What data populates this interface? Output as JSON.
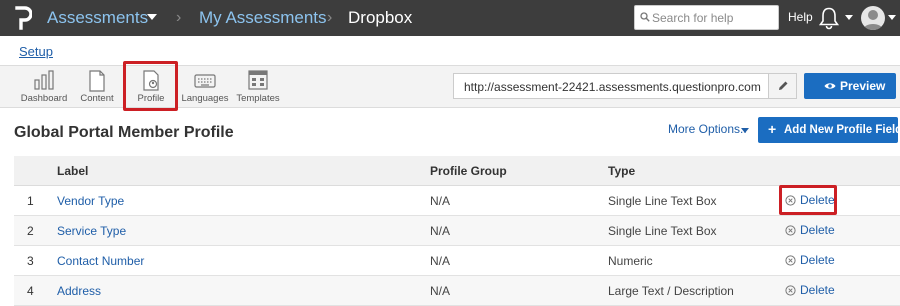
{
  "topbar": {
    "crumb_assessments": "Assessments",
    "crumb_my_assessments": "My Assessments",
    "crumb_current": "Dropbox",
    "separator": "›",
    "search_placeholder": "Search for help",
    "help_label": "Help"
  },
  "setup": {
    "link_label": "Setup"
  },
  "toolbar": {
    "items": [
      {
        "label": "Dashboard",
        "icon": "bar-chart-icon"
      },
      {
        "label": "Content",
        "icon": "document-icon"
      },
      {
        "label": "Profile",
        "icon": "profile-card-icon",
        "highlighted": true
      },
      {
        "label": "Languages",
        "icon": "keyboard-icon"
      },
      {
        "label": "Templates",
        "icon": "template-grid-icon"
      }
    ],
    "url_value": "http://assessment-22421.assessments.questionpro.com",
    "preview_label": "Preview"
  },
  "page": {
    "title": "Global Portal Member Profile",
    "more_options_label": "More Options..",
    "add_button_plus": "+",
    "add_button_label": "Add New Profile Field"
  },
  "table": {
    "headers": {
      "label": "Label",
      "group": "Profile Group",
      "type": "Type"
    },
    "rows": [
      {
        "num": "1",
        "label": "Vendor Type",
        "group": "N/A",
        "type": "Single Line Text Box",
        "action": "Delete",
        "highlighted": true
      },
      {
        "num": "2",
        "label": "Service Type",
        "group": "N/A",
        "type": "Single Line Text Box",
        "action": "Delete"
      },
      {
        "num": "3",
        "label": "Contact Number",
        "group": "N/A",
        "type": "Numeric",
        "action": "Delete"
      },
      {
        "num": "4",
        "label": "Address",
        "group": "N/A",
        "type": "Large Text / Description",
        "action": "Delete"
      }
    ]
  },
  "colors": {
    "topbar_bg": "#3d3d3d",
    "breadcrumb_link": "#8cc3ee",
    "primary_button": "#1b6dc1",
    "link": "#1f5ea8",
    "highlight_box": "#cc1f24"
  }
}
